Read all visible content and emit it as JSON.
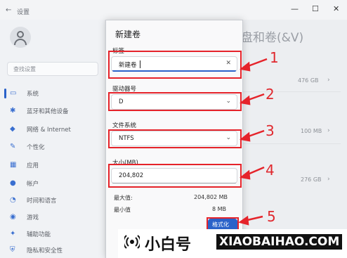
{
  "window": {
    "title": "设置",
    "back_glyph": "←",
    "controls": [
      "—",
      "☐",
      "✕"
    ]
  },
  "sidebar": {
    "search_placeholder": "查找设置",
    "items": [
      {
        "label": "系统",
        "icon": "system-icon",
        "glyph": "▭",
        "active": true
      },
      {
        "label": "蓝牙和其他设备",
        "icon": "bluetooth-icon",
        "glyph": "✱"
      },
      {
        "label": "网络 & Internet",
        "icon": "network-icon",
        "glyph": "◆"
      },
      {
        "label": "个性化",
        "icon": "brush-icon",
        "glyph": "✎"
      },
      {
        "label": "应用",
        "icon": "apps-icon",
        "glyph": "▦"
      },
      {
        "label": "帐户",
        "icon": "account-icon",
        "glyph": "●"
      },
      {
        "label": "时间和语言",
        "icon": "clock-icon",
        "glyph": "◔"
      },
      {
        "label": "游戏",
        "icon": "game-icon",
        "glyph": "◉"
      },
      {
        "label": "辅助功能",
        "icon": "accessibility-icon",
        "glyph": "✦"
      },
      {
        "label": "隐私和安全性",
        "icon": "shield-icon",
        "glyph": "⛨"
      }
    ]
  },
  "background": {
    "heading": "盘和卷(&V)",
    "values": [
      "476 GB",
      "100 MB",
      "276 GB"
    ],
    "chevron": "›"
  },
  "dialog": {
    "title": "新建卷",
    "label_field": {
      "label": "标签",
      "value": "新建卷",
      "clear_icon": "✕"
    },
    "drive_letter": {
      "label": "驱动器号",
      "value": "D",
      "chevron": "⌄"
    },
    "file_system": {
      "label": "文件系统",
      "value": "NTFS",
      "chevron": "⌄"
    },
    "size": {
      "label": "大小(MB)",
      "value": "204,802"
    },
    "max_label": "最大值:",
    "max_value": "204,802 MB",
    "min_label": "最小值",
    "min_value": "8 MB",
    "format_button": "格式化"
  },
  "annotations": {
    "numbers": [
      "1",
      "2",
      "3",
      "4",
      "5"
    ],
    "color": "#e5232a"
  },
  "watermark": {
    "brand_cn": "小白号",
    "brand_en": "XIAOBAIHAO.COM"
  }
}
